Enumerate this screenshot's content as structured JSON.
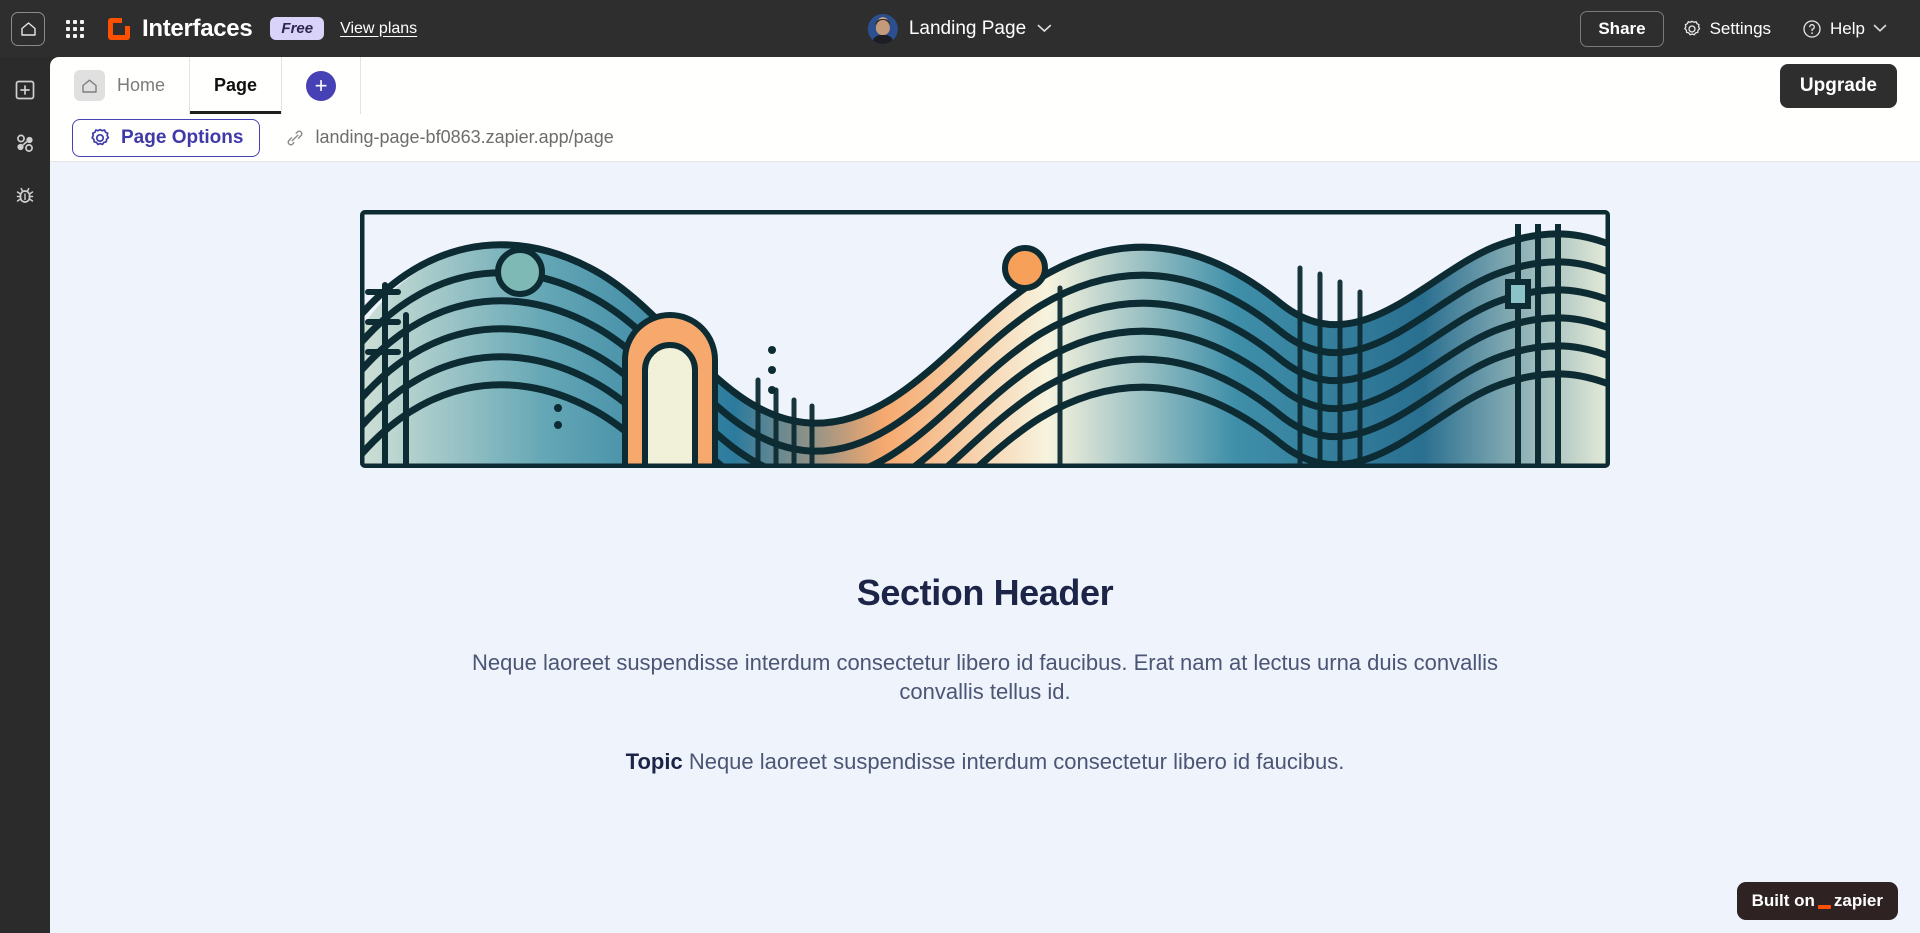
{
  "topbar": {
    "home_icon": "house-icon",
    "apps_icon": "apps-grid-icon",
    "brand_icon": "interfaces-logo-icon",
    "brand_name": "Interfaces",
    "plan_badge": "Free",
    "view_plans": "View plans",
    "doc_title": "Landing Page",
    "doc_chevron_icon": "chevron-down-icon",
    "share_label": "Share",
    "settings_label": "Settings",
    "settings_icon": "gear-icon",
    "help_label": "Help",
    "help_icon": "question-circle-icon",
    "help_chevron_icon": "chevron-down-icon"
  },
  "rail": {
    "items": [
      {
        "icon": "add-square-icon",
        "name": "add-element"
      },
      {
        "icon": "nodes-icon",
        "name": "connections"
      },
      {
        "icon": "bug-icon",
        "name": "debug"
      }
    ]
  },
  "tabs": {
    "items": [
      {
        "label": "Home",
        "icon": "house-icon",
        "active": false
      },
      {
        "label": "Page",
        "icon": "",
        "active": true
      }
    ],
    "add_label": "+",
    "upgrade_label": "Upgrade"
  },
  "options": {
    "page_options_label": "Page Options",
    "page_options_icon": "gear-icon",
    "link_icon": "link-icon",
    "url": "landing-page-bf0863.zapier.app/page"
  },
  "canvas": {
    "hero_alt": "abstract-wave-illustration",
    "section_header": "Section Header",
    "section_body": "Neque laoreet suspendisse interdum consectetur libero id faucibus. Erat nam at lectus urna duis convallis convallis tellus id.",
    "topic_label": "Topic",
    "topic_body": "Neque laoreet suspendisse interdum consectetur libero id faucibus.",
    "badge_prefix": "Built on",
    "badge_brand": "zapier"
  },
  "colors": {
    "brand_orange": "#ff4f00",
    "accent_indigo": "#4641b4",
    "canvas_bg": "#eff3fc",
    "chrome_dark": "#2e2e2e",
    "heading_navy": "#1c2448"
  }
}
